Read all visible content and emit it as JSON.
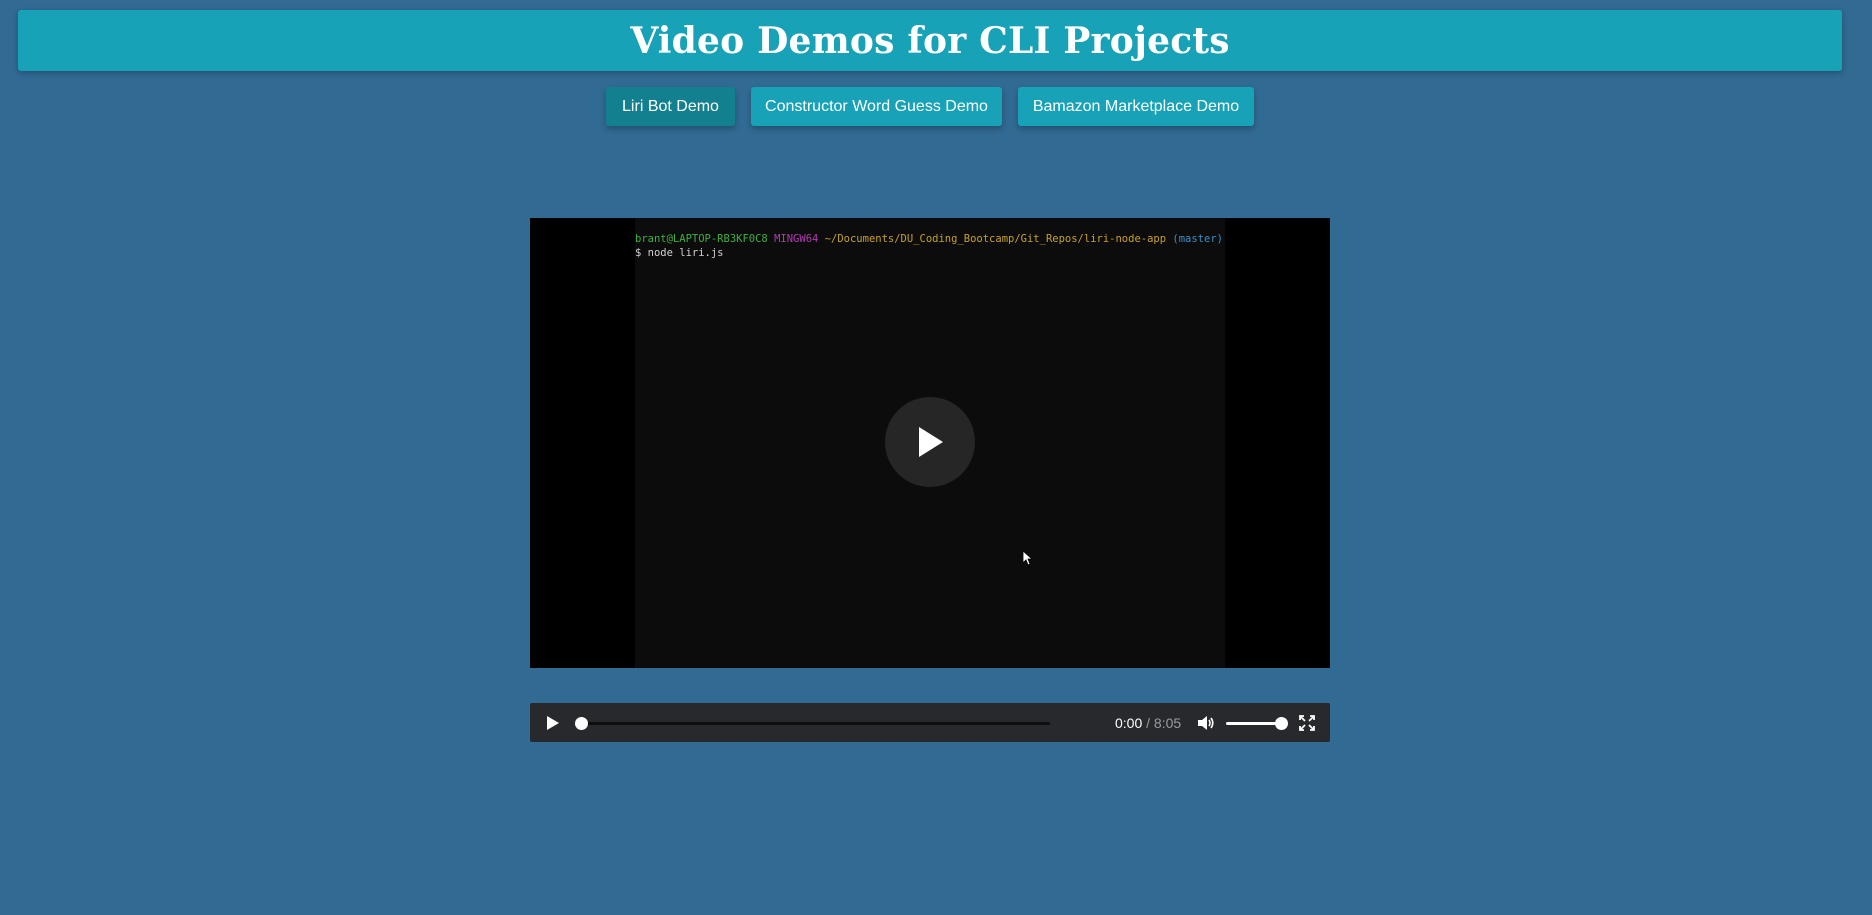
{
  "header": {
    "title": "Video Demos for CLI Projects"
  },
  "nav": {
    "buttons": [
      {
        "label": "Liri Bot Demo",
        "active": true
      },
      {
        "label": "Constructor Word Guess Demo",
        "active": false
      },
      {
        "label": "Bamazon Marketplace Demo",
        "active": false
      }
    ]
  },
  "video": {
    "terminal": {
      "user_host": "brant@LAPTOP-RB3KF0C8",
      "env": "MINGW64",
      "path": "~/Documents/DU_Coding_Bootcamp/Git_Repos/liri-node-app",
      "branch": "(master)",
      "command": "$ node liri.js"
    },
    "controls": {
      "current_time": "0:00",
      "separator": "/",
      "duration": "8:05",
      "progress": 0,
      "volume": 1.0
    }
  },
  "colors": {
    "background": "#316a93",
    "accent": "#17a2b8",
    "accent_active": "#13808f",
    "controls_bg": "#27292c"
  },
  "icons": [
    "play-icon",
    "play-large-icon",
    "volume-icon",
    "fullscreen-icon",
    "mouse-cursor-icon"
  ]
}
